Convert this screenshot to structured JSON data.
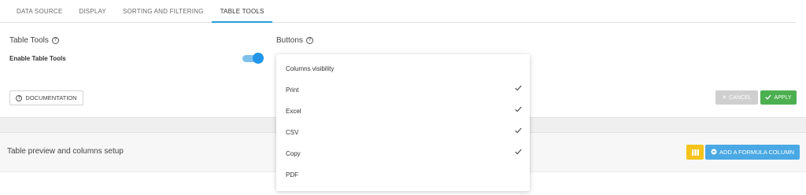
{
  "tabs": [
    {
      "label": "DATA SOURCE",
      "active": false
    },
    {
      "label": "DISPLAY",
      "active": false
    },
    {
      "label": "SORTING AND FILTERING",
      "active": false
    },
    {
      "label": "TABLE TOOLS",
      "active": true
    }
  ],
  "table_tools": {
    "title": "Table Tools",
    "help_icon": "help-circle-icon",
    "enable_label": "Enable Table Tools",
    "enabled": true
  },
  "buttons_section": {
    "title": "Buttons",
    "help_icon": "help-circle-icon"
  },
  "dropdown": {
    "items": [
      {
        "label": "Columns visibility",
        "checked": false
      },
      {
        "label": "Print",
        "checked": true
      },
      {
        "label": "Excel",
        "checked": true
      },
      {
        "label": "CSV",
        "checked": true
      },
      {
        "label": "Copy",
        "checked": true
      },
      {
        "label": "PDF",
        "checked": false
      }
    ]
  },
  "footer": {
    "documentation_label": "DOCUMENTATION",
    "cancel_label": "CANCEL",
    "apply_label": "APPLY"
  },
  "preview": {
    "title": "Table preview and columns setup",
    "add_formula_label": "ADD A FORMULA COLUMN"
  },
  "colors": {
    "accent": "#2b9bd8",
    "toggle_on": "#2196e8",
    "apply_green": "#4caf50",
    "cancel_grey": "#cfcfcf",
    "columns_yellow": "#f5c31c",
    "formula_blue": "#4aa8e4"
  }
}
